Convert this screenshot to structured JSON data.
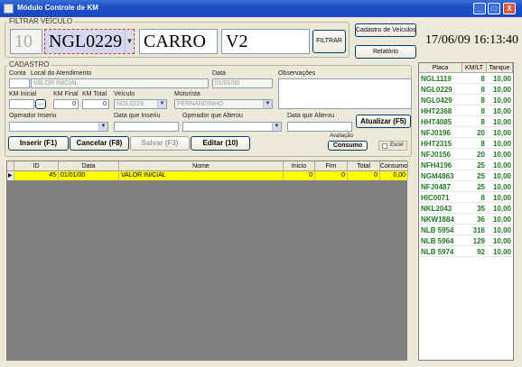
{
  "window": {
    "title": "Módulo Controle de KM",
    "btn_min": "_",
    "btn_max": "□",
    "btn_close": "X"
  },
  "filter": {
    "group_label": "FILTRAR VEÍCULO",
    "code": "10",
    "plate": "NGL0229",
    "type": "CARRO",
    "model": "V2",
    "filter_button": "FILTRAR"
  },
  "top_buttons": {
    "vehicles": "Cadastro de Veículos",
    "reports": "Relatório"
  },
  "datetime": "17/06/09 16:13:40",
  "cadastro": {
    "group_label": "CADASTRO",
    "labels": {
      "conta": "Conta",
      "local": "Local do Atendimento",
      "data": "Data",
      "observacoes": "Observações",
      "km_inicial": "KM Inicial",
      "km_final": "KM Final",
      "km_total": "KM Total",
      "veiculo": "Veículo",
      "motorista": "Motorista",
      "op_inseriu": "Operador Inseriu",
      "data_inseriu": "Data que Inseriu",
      "op_alterou": "Operador que Alterou",
      "data_alterou": "Data que Alterou"
    },
    "values": {
      "local": "VALOR INICIAL",
      "data": "01/01/00",
      "km_final": "0",
      "km_total": "0",
      "veiculo": "NGL0229",
      "motorista": "FERNANDINHO"
    },
    "atualizar_button": "Atualizar (F5)",
    "avaliacao_label": "Avaliação",
    "consumo_button": "Consumo",
    "excel_label": "Excel"
  },
  "actions": {
    "inserir": "Inserir (F1)",
    "cancelar": "Cancelar (F8)",
    "salvar": "Salvar (F3)",
    "editar": "Editar (10)"
  },
  "grid": {
    "columns": [
      "ID",
      "Data",
      "Nome",
      "Inicio",
      "Fim",
      "Total",
      "Consumo"
    ],
    "rows": [
      {
        "id": "45",
        "data": "01/01/00",
        "nome": "VALOR INICIAL",
        "inicio": "0",
        "fim": "0",
        "total": "0",
        "consumo": "0,00"
      }
    ]
  },
  "side_table": {
    "columns": [
      "Placa",
      "KM/LT",
      "Tanque"
    ],
    "rows": [
      {
        "placa": "NGL1119",
        "km": "8",
        "tanque": "10,00"
      },
      {
        "placa": "NGL0229",
        "km": "8",
        "tanque": "10,00"
      },
      {
        "placa": "NGL0429",
        "km": "8",
        "tanque": "10,00"
      },
      {
        "placa": "HHT2368",
        "km": "8",
        "tanque": "10,00"
      },
      {
        "placa": "HHT4085",
        "km": "8",
        "tanque": "10,00"
      },
      {
        "placa": "NFJ0196",
        "km": "20",
        "tanque": "10,00"
      },
      {
        "placa": "HHT2315",
        "km": "8",
        "tanque": "10,00"
      },
      {
        "placa": "NFJ0156",
        "km": "20",
        "tanque": "10,00"
      },
      {
        "placa": "NFH4196",
        "km": "25",
        "tanque": "10,00"
      },
      {
        "placa": "NGM4863",
        "km": "25",
        "tanque": "10,00"
      },
      {
        "placa": "NFJ0487",
        "km": "25",
        "tanque": "10,00"
      },
      {
        "placa": "HIC0071",
        "km": "8",
        "tanque": "10,00"
      },
      {
        "placa": "NKL2043",
        "km": "35",
        "tanque": "10,00"
      },
      {
        "placa": "NKW1884",
        "km": "36",
        "tanque": "10,00"
      },
      {
        "placa": "NLB 5954",
        "km": "316",
        "tanque": "10,00"
      },
      {
        "placa": "NLB 5964",
        "km": "129",
        "tanque": "10,00"
      },
      {
        "placa": "NLB 5974",
        "km": "92",
        "tanque": "10,00"
      }
    ]
  }
}
